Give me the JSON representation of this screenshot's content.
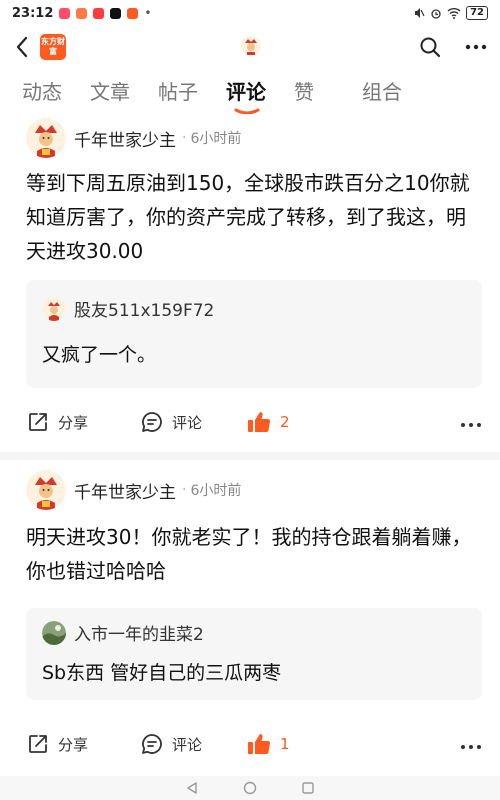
{
  "status": {
    "time": "23:12",
    "battery": "72"
  },
  "app": {
    "logo_text": "东方财富"
  },
  "tabs": [
    "动态",
    "文章",
    "帖子",
    "评论",
    "赞",
    "组合"
  ],
  "accent_color": "#ff5a1f",
  "posts": [
    {
      "username": "千年世家少主",
      "dot": "·",
      "time": "6小时前",
      "text": "等到下周五原油到150，全球股市跌百分之10你就知道厉害了，你的资产完成了转移，到了我这，明天进攻30.00",
      "reply": {
        "username": "股友511x159F72",
        "text": "又疯了一个。"
      },
      "share_label": "分享",
      "comment_label": "评论",
      "likes": "2"
    },
    {
      "username": "千年世家少主",
      "dot": "·",
      "time": "6小时前",
      "text": "明天进攻30！你就老实了！我的持仓跟着躺着赚，你也错过哈哈哈",
      "reply": {
        "username": "入市一年的韭菜2",
        "text": "Sb东西 管好自己的三瓜两枣"
      },
      "share_label": "分享",
      "comment_label": "评论",
      "likes": "1"
    }
  ]
}
